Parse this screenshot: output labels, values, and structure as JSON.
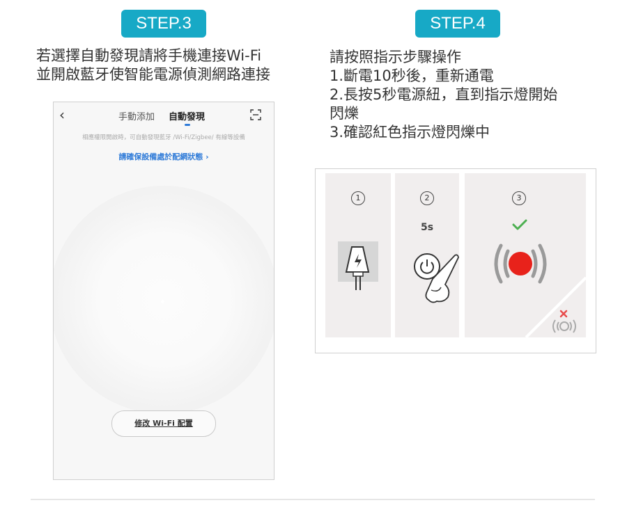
{
  "step3": {
    "badge": "STEP.3",
    "lines": [
      "若選擇自動發現請將手機連接Wi-Fi",
      "並開啟藍牙使智能電源偵測網路連接"
    ]
  },
  "phone": {
    "tab_manual": "手動添加",
    "tab_auto": "自動發現",
    "hint": "相應權限開啟時，可自動發現藍牙 /Wi-Fi/Zigbee/ 有線等設備",
    "confirm_link": "請確保設備處於配網狀態 ›",
    "wifi_button": "修改 Wi-Fi 配置",
    "icons": [
      "back-arrow-icon",
      "scan-icon"
    ]
  },
  "step4": {
    "badge": "STEP.4",
    "lines": [
      "請按照指示步驟操作",
      "1.斷電10秒後，重新通電",
      "2.長按5秒電源紐，直到指示燈開始",
      "閃爍",
      "3.確認紅色指示燈閃爍中"
    ]
  },
  "illustration": {
    "panels": [
      {
        "num": "1",
        "icon": "unplug-power-icon"
      },
      {
        "num": "2",
        "label": "5s",
        "icon": "press-power-button-icon"
      },
      {
        "num": "3",
        "icon": "red-blinking-light-icon"
      }
    ],
    "colors": {
      "badge": "#17a9c6",
      "check": "#4caf50",
      "red_light": "#e8221b",
      "wrong": "#e84c4c",
      "panel": "#f1eeee",
      "link": "#2f7bd8"
    }
  }
}
